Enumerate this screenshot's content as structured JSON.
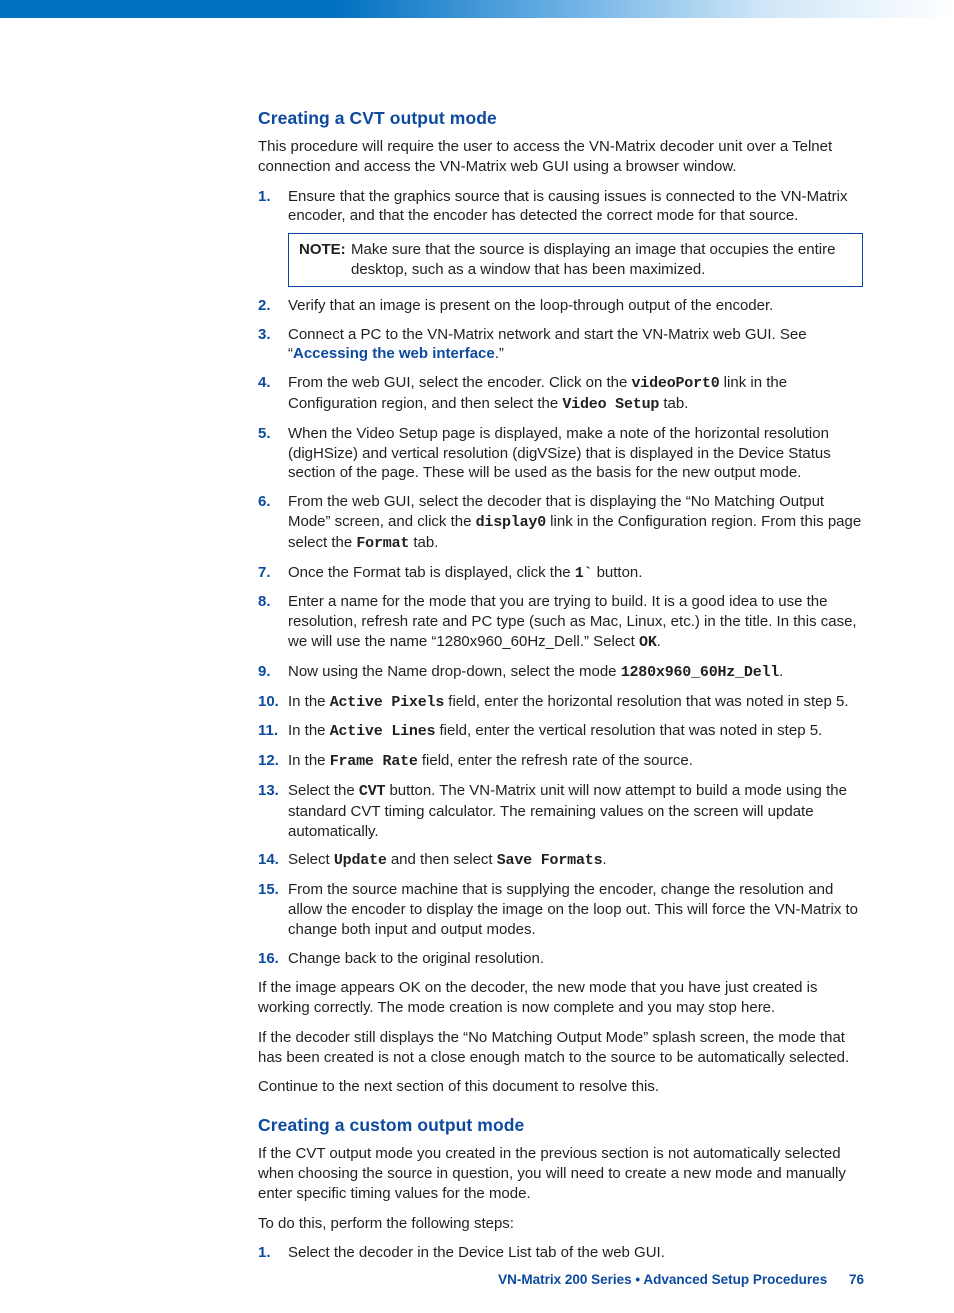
{
  "section1": {
    "title": "Creating a CVT output mode",
    "intro": "This procedure will require the user to access the VN-Matrix decoder unit over a Telnet connection and access the VN-Matrix web GUI using a browser window.",
    "steps": {
      "s1": {
        "num": "1.",
        "text": "Ensure that the graphics source that is causing issues is connected to the VN-Matrix encoder, and that the encoder has detected the correct mode for that source.",
        "note_label": "NOTE:",
        "note_text": "Make sure that the source is displaying an image that occupies the entire desktop, such as a window that has been maximized."
      },
      "s2": {
        "num": "2.",
        "text": "Verify that an image is present on the loop-through output of the encoder."
      },
      "s3": {
        "num": "3.",
        "pre": "Connect a PC to the VN-Matrix network and start the VN-Matrix web GUI. See “",
        "link": "Accessing the web interface",
        "post": ".”"
      },
      "s4": {
        "num": "4.",
        "a": "From the web GUI, select the encoder. Click on the ",
        "m1": "videoPort0",
        "b": " link in the Configuration region, and then select the ",
        "m2": "Video Setup",
        "c": " tab."
      },
      "s5": {
        "num": "5.",
        "text": "When the Video Setup page is displayed, make a note of the horizontal resolution (digHSize) and vertical resolution (digVSize) that is displayed in the Device Status section of the page. These will be used as the basis for the new output mode."
      },
      "s6": {
        "num": "6.",
        "a": "From the web GUI, select the decoder that is displaying the “No Matching Output Mode” screen, and click the ",
        "m1": "display0",
        "b": " link in the Configuration region. From this page select the ",
        "m2": "Format",
        "c": " tab."
      },
      "s7": {
        "num": "7.",
        "a": "Once the Format tab is displayed, click the ",
        "m1": "1`",
        "b": " button."
      },
      "s8": {
        "num": "8.",
        "a": "Enter a name for the mode that you are trying to build. It is a good idea to use the resolution, refresh rate and PC type (such as Mac, Linux, etc.) in the title. In this case, we will use the name “1280x960_60Hz_Dell.” Select ",
        "m1": "OK",
        "b": "."
      },
      "s9": {
        "num": "9.",
        "a": "Now using the Name drop-down, select the mode ",
        "m1": "1280x960_60Hz_Dell",
        "b": "."
      },
      "s10": {
        "num": "10.",
        "a": "In the ",
        "m1": "Active Pixels",
        "b": " field, enter the horizontal resolution that was noted in step 5."
      },
      "s11": {
        "num": "11.",
        "a": "In the ",
        "m1": "Active Lines",
        "b": " field, enter the vertical resolution that was noted in step 5."
      },
      "s12": {
        "num": "12.",
        "a": "In the ",
        "m1": "Frame Rate",
        "b": " field, enter the refresh rate of the source."
      },
      "s13": {
        "num": "13.",
        "a": "Select the ",
        "m1": "CVT",
        "b": " button. The VN-Matrix unit will now attempt to build a mode using the standard CVT timing calculator. The remaining values on the screen will update automatically."
      },
      "s14": {
        "num": "14.",
        "a": "Select ",
        "m1": "Update",
        "b": " and then select ",
        "m2": "Save Formats",
        "c": "."
      },
      "s15": {
        "num": "15.",
        "text": "From the source machine that is supplying the encoder, change the resolution and allow the encoder to display the image on the loop out. This will force the VN-Matrix to change both input and output modes."
      },
      "s16": {
        "num": "16.",
        "text": "Change back to the original resolution."
      }
    },
    "para_after1": "If the image appears OK on the decoder, the new mode that you have just created is working correctly. The mode creation is now complete and you may stop here.",
    "para_after2": "If the decoder still displays the “No Matching Output Mode” splash screen, the mode that has been created is not a close enough match to the source to be automatically selected.",
    "para_after3": "Continue to the next section of this document to resolve this."
  },
  "section2": {
    "title": "Creating a custom output mode",
    "intro": "If the CVT output mode you created in the previous section is not automatically selected when choosing the source in question, you will need to create a new mode and manually enter specific timing values for the mode.",
    "intro2": "To do this, perform the following steps:",
    "steps": {
      "s1": {
        "num": "1.",
        "text": "Select the decoder in the Device List tab of the web GUI."
      }
    }
  },
  "footer": {
    "text": "VN-Matrix 200 Series  •  Advanced Setup Procedures",
    "page": "76"
  }
}
